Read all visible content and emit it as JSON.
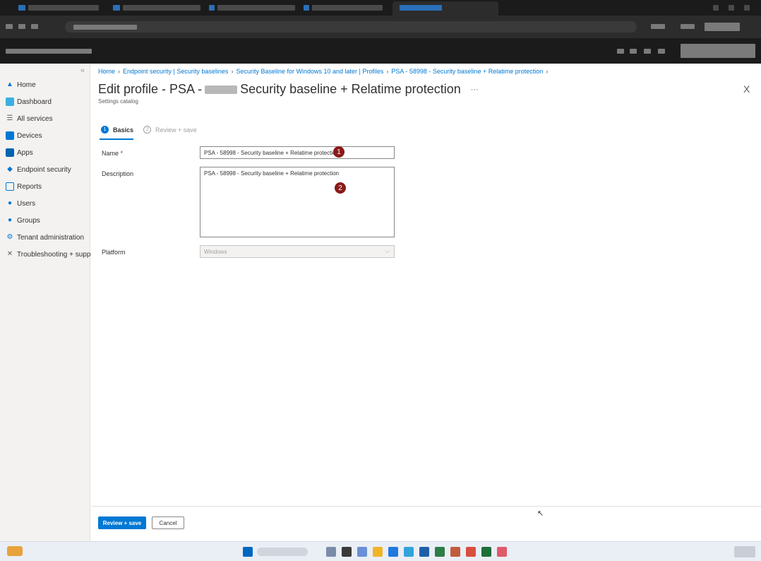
{
  "leftnav": {
    "items": [
      {
        "label": "Home",
        "icon": "home-icon"
      },
      {
        "label": "Dashboard",
        "icon": "dashboard-icon"
      },
      {
        "label": "All services",
        "icon": "list-icon"
      },
      {
        "label": "Devices",
        "icon": "devices-icon"
      },
      {
        "label": "Apps",
        "icon": "apps-icon"
      },
      {
        "label": "Endpoint security",
        "icon": "shield-icon"
      },
      {
        "label": "Reports",
        "icon": "reports-icon"
      },
      {
        "label": "Users",
        "icon": "user-icon"
      },
      {
        "label": "Groups",
        "icon": "groups-icon"
      },
      {
        "label": "Tenant administration",
        "icon": "tenant-icon"
      },
      {
        "label": "Troubleshooting + support",
        "icon": "tools-icon"
      }
    ]
  },
  "breadcrumb": {
    "items": [
      "Home",
      "Endpoint security | Security baselines",
      "Security Baseline for Windows 10 and later | Profiles",
      "PSA - 58998 - Security baseline + Relatime protection"
    ]
  },
  "page": {
    "title_prefix": "Edit profile - PSA -",
    "title_suffix": "Security baseline + Relatime protection",
    "more": "···",
    "subtitle": "Settings catalog",
    "close": "X"
  },
  "steps": [
    {
      "number": "1",
      "label": "Basics",
      "active": true
    },
    {
      "number": "2",
      "label": "Review + save",
      "active": false
    }
  ],
  "form": {
    "name_label": "Name",
    "name_required": "*",
    "name_value": "PSA - 58998 - Security baseline + Relatime protection",
    "description_label": "Description",
    "description_value": "PSA - 58998 - Security baseline + Relatime protection",
    "platform_label": "Platform",
    "platform_value": "Windows"
  },
  "callouts": [
    "1",
    "2"
  ],
  "footer": {
    "primary_label": "Review + save",
    "secondary_label": "Cancel"
  }
}
